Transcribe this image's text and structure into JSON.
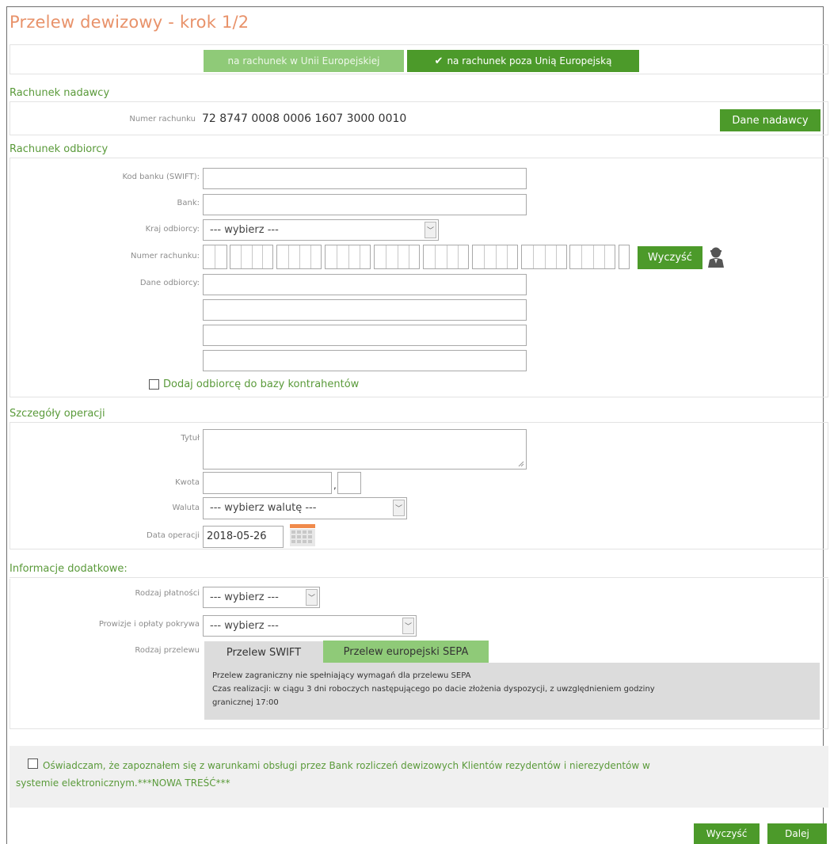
{
  "page": {
    "title": "Przelew dewizowy - krok 1/2"
  },
  "destination_toggle": {
    "eu_label": "na rachunek w Unii Europejskiej",
    "non_eu_label": "na rachunek poza Unią Europejską",
    "check_glyph": "✔"
  },
  "sender": {
    "section_title": "Rachunek nadawcy",
    "account_label": "Numer rachunku",
    "account_number": "72 8747 0008 0006 1607 3000 0010",
    "details_button": "Dane nadawcy"
  },
  "recipient": {
    "section_title": "Rachunek odbiorcy",
    "swift_label": "Kod banku (SWIFT):",
    "bank_label": "Bank:",
    "country_label": "Kraj odbiorcy:",
    "country_value": "--- wybierz ---",
    "account_label": "Numer rachunku:",
    "clear_button": "Wyczyść",
    "details_label": "Dane odbiorcy:",
    "add_to_contacts_label": "Dodaj odbiorcę do bazy kontrahentów"
  },
  "operation": {
    "section_title": "Szczegóły operacji",
    "title_label": "Tytuł",
    "amount_label": "Kwota",
    "amount_separator": ",",
    "currency_label": "Waluta",
    "currency_value": "--- wybierz walutę ---",
    "date_label": "Data operacji",
    "date_value": "2018-05-26"
  },
  "additional": {
    "section_title": "Informacje dodatkowe:",
    "payment_type_label": "Rodzaj płatności",
    "payment_type_value": "--- wybierz ---",
    "fees_label": "Prowizje i opłaty pokrywa",
    "fees_value": "--- wybierz ---",
    "transfer_type_label": "Rodzaj przelewu",
    "tabs": [
      "Przelew SWIFT",
      "Przelew europejski SEPA"
    ],
    "info_line1": "Przelew zagraniczny nie spełniający wymagań dla przelewu SEPA",
    "info_line2": "Czas realizacji: w ciągu 3 dni roboczych następującego po dacie złożenia dyspozycji, z uwzględnieniem godziny",
    "info_line3": "granicznej 17:00"
  },
  "consent": {
    "text_line1": "Oświadczam, że zapoznałem się z warunkami obsługi przez Bank rozliczeń dewizowych Klientów rezydentów i nierezydentów w",
    "text_line2": "systemie elektronicznym.***NOWA TREŚĆ***"
  },
  "footer": {
    "clear_button": "Wyczyść",
    "next_button": "Dalej"
  },
  "colors": {
    "title": "#e8926a",
    "section": "#5a9a3a",
    "button_dark": "#4c9a2a",
    "button_light": "#8fca78"
  }
}
